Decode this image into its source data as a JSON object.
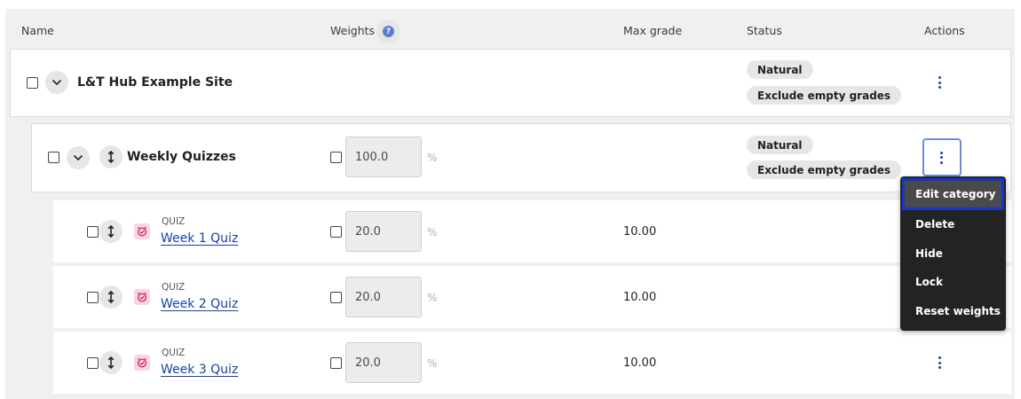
{
  "header": {
    "name": "Name",
    "weights": "Weights",
    "max_grade": "Max grade",
    "status": "Status",
    "actions": "Actions",
    "help_icon": "question-circle-icon"
  },
  "site_row": {
    "name": "L&T Hub Example Site",
    "badges": [
      "Natural",
      "Exclude empty grades"
    ]
  },
  "category_row": {
    "name": "Weekly Quizzes",
    "weight": "100.0",
    "pct": "%",
    "badges": [
      "Natural",
      "Exclude empty grades"
    ]
  },
  "quiz_rows": [
    {
      "type": "QUIZ",
      "name": "Week 1 Quiz",
      "weight": "20.0",
      "pct": "%",
      "max_grade": "10.00"
    },
    {
      "type": "QUIZ",
      "name": "Week 2 Quiz",
      "weight": "20.0",
      "pct": "%",
      "max_grade": "10.00"
    },
    {
      "type": "QUIZ",
      "name": "Week 3 Quiz",
      "weight": "20.0",
      "pct": "%",
      "max_grade": "10.00"
    }
  ],
  "actions_menu": {
    "items": [
      "Edit category",
      "Delete",
      "Hide",
      "Lock",
      "Reset weights"
    ],
    "highlighted": "Edit category"
  },
  "colors": {
    "link": "#1442a8",
    "menu_bg": "#232323",
    "focus_outline": "#1437c9",
    "quiz_icon_bg": "#f9d4e1",
    "quiz_icon_fg": "#c2185b"
  }
}
